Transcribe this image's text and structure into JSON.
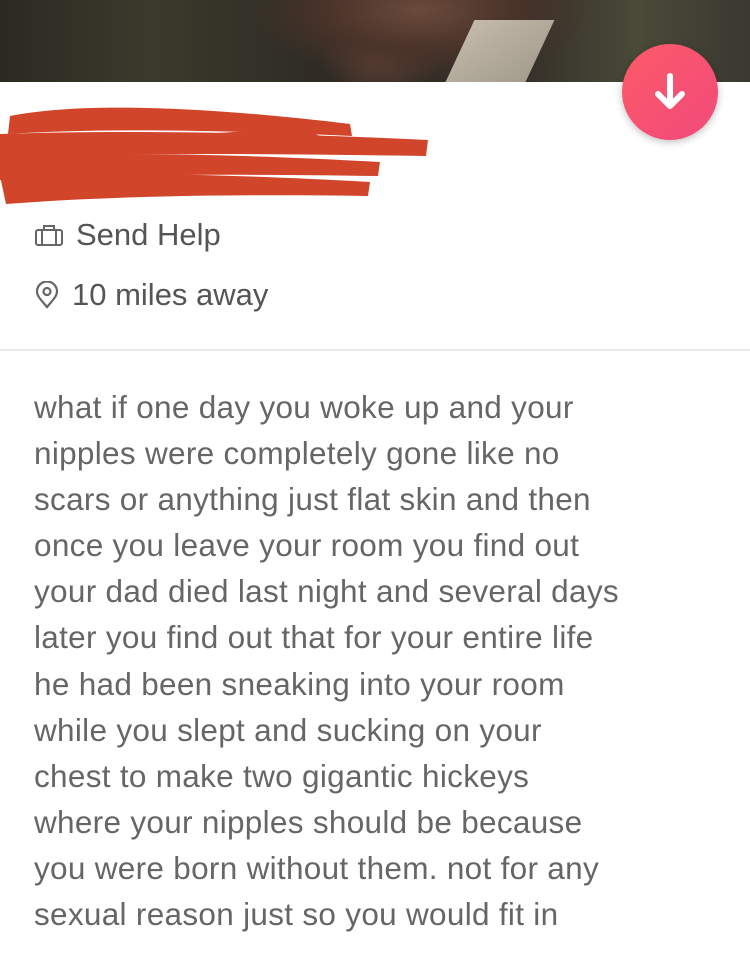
{
  "profile": {
    "job": "Send Help",
    "distance": "10 miles away",
    "name_redacted": true
  },
  "bio_lines": [
    "what if one day you woke up and your",
    "nipples were completely gone like no",
    "scars or anything just flat skin and then",
    "once you leave your room you find out",
    "your dad died last night and several days",
    "later you find out that for your entire life",
    "he had been sneaking into your room",
    "while you slept and sucking on your",
    "chest to make two gigantic hickeys",
    "where your nipples should be because",
    "you were born without them. not for any",
    "sexual reason just so you would fit in"
  ],
  "icons": {
    "collapse": "arrow-down-icon",
    "job": "briefcase-icon",
    "location": "location-pin-icon"
  },
  "colors": {
    "accent": "#fd5a6a",
    "redaction": "#d1462b",
    "text": "#666666"
  }
}
